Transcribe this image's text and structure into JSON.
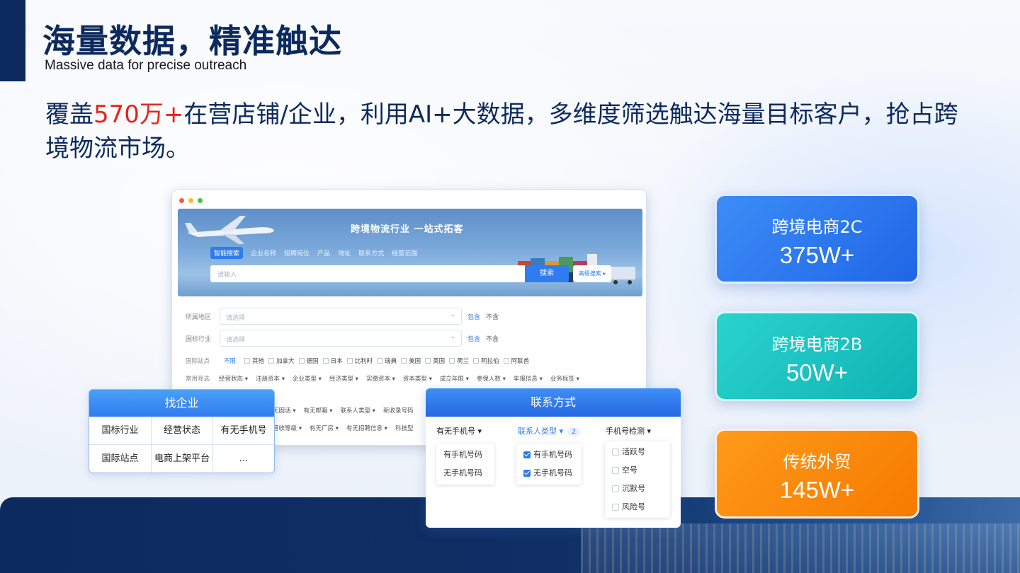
{
  "header": {
    "title": "海量数据，精准触达",
    "subtitle": "Massive data for precise outreach",
    "intro_pre": "覆盖",
    "intro_highlight": "570万+",
    "intro_post": "在营店铺/企业，利用AI+大数据，多维度筛选触达海量目标客户，抢占跨境物流市场。"
  },
  "browser": {
    "banner_title": "跨境物流行业 一站式拓客",
    "tabs": [
      "智能搜索",
      "企业名称",
      "招聘岗位",
      "产品",
      "地址",
      "联系方式",
      "经营范围"
    ],
    "search_placeholder": "请输入",
    "search_button": "搜索",
    "advanced_button": "高级搜索 ▸",
    "filters": [
      {
        "label": "所属地区",
        "placeholder": "请选择",
        "include": "包含",
        "exclude": "不含"
      },
      {
        "label": "国标行业",
        "placeholder": "请选择",
        "include": "包含",
        "exclude": "不含"
      }
    ],
    "site_label": "国际站点",
    "site_unlimited": "不限",
    "sites": [
      "其他",
      "加拿大",
      "德国",
      "日本",
      "比利时",
      "瑞典",
      "美国",
      "英国",
      "荷兰",
      "阿拉伯",
      "阿联酋"
    ],
    "common_label": "常用筛选",
    "common_filters": [
      "经营状态",
      "注册资本",
      "企业类型",
      "经济类型",
      "实缴资本",
      "资本类型",
      "成立年限",
      "参保人数",
      "年报信息",
      "业务标签"
    ],
    "row3": [
      "无固话",
      "有无邮箱",
      "联系人类型",
      "新收录号码"
    ],
    "row4": [
      "营收等级",
      "有无厂房",
      "有无招聘信息",
      "科技型"
    ]
  },
  "company_card": {
    "title": "找企业",
    "cells": [
      "国标行业",
      "经营状态",
      "有无手机号",
      "国际站点",
      "电商上架平台",
      "..."
    ]
  },
  "contact_card": {
    "title": "联系方式",
    "col1_head": "有无手机号 ▾",
    "col2_head": "联系人类型 ▾",
    "col2_badge": "2",
    "col3_head": "手机号检测 ▾",
    "col1_options": [
      "有手机号码",
      "无手机号码"
    ],
    "col2_options": [
      "有手机号码",
      "无手机号码"
    ],
    "col3_options": [
      "活跃号",
      "空号",
      "沉默号",
      "风险号"
    ]
  },
  "stats": [
    {
      "title": "跨境电商2C",
      "value": "375W+",
      "color": "#2f7cf0"
    },
    {
      "title": "跨境电商2B",
      "value": "50W+",
      "color": "#19c4c0"
    },
    {
      "title": "传统外贸",
      "value": "145W+",
      "color": "#ff8a00"
    }
  ]
}
